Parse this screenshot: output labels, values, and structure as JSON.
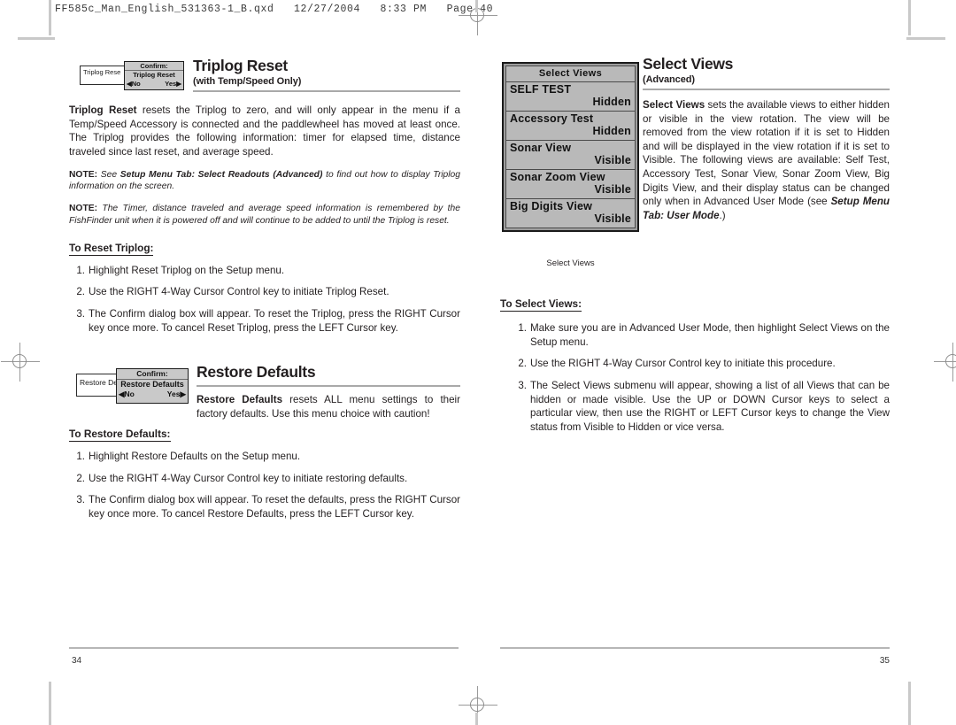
{
  "prepress": {
    "header": "FF585c_Man_English_531363-1_B.qxd   12/27/2004   8:33 PM   Page 40"
  },
  "left_page": {
    "folio": "34",
    "triplog": {
      "title": "Triplog Reset",
      "subtitle": "(with Temp/Speed Only)",
      "figure": {
        "menu_item": "Triplog Rese",
        "dialog_title": "Confirm:",
        "dialog_body": "Triplog Reset",
        "dialog_no": "◀No",
        "dialog_yes": "Yes▶"
      },
      "intro_bold": "Triplog Reset",
      "intro_text": " resets the Triplog to zero, and will only appear in the menu if a Temp/Speed Accessory is connected and the paddlewheel has moved at least once. The Triplog provides the following information: timer for elapsed time, distance traveled since last reset, and average speed.",
      "note1_label": "NOTE:",
      "note1_pre": " See ",
      "note1_bold": "Setup Menu Tab: Select Readouts (Advanced)",
      "note1_post": " to find out how to display Triplog information on the screen.",
      "note2_label": "NOTE:",
      "note2_text": " The Timer, distance traveled and average speed information is remembered by the FishFinder unit when it is powered off and will continue to be added to until the Triplog is reset.",
      "procedure_heading": "To Reset Triplog:",
      "steps": [
        {
          "num": "1.",
          "text": "Highlight Reset Triplog on the Setup menu."
        },
        {
          "num": "2.",
          "text": "Use the RIGHT 4-Way Cursor Control key to initiate Triplog Reset."
        },
        {
          "num": "3.",
          "text": "The Confirm dialog box will appear. To reset the Triplog, press the RIGHT Cursor key once more. To cancel Reset Triplog, press the LEFT Cursor key."
        }
      ]
    },
    "restore": {
      "title": "Restore Defaults",
      "figure": {
        "menu_item": "Restore De",
        "dialog_title": "Confirm:",
        "dialog_body": "Restore Defaults",
        "dialog_no": "◀No",
        "dialog_yes": "Yes▶"
      },
      "intro_bold": "Restore Defaults",
      "intro_text": " resets ALL menu settings to their factory defaults. Use this menu choice with caution!",
      "procedure_heading": "To Restore Defaults:",
      "steps": [
        {
          "num": "1.",
          "text": "Highlight Restore Defaults on the Setup menu."
        },
        {
          "num": "2.",
          "text": "Use the RIGHT 4-Way Cursor Control key to initiate restoring defaults."
        },
        {
          "num": "3.",
          "text": "The Confirm dialog box will appear. To reset the defaults,  press the RIGHT Cursor key once more. To cancel Restore Defaults, press the LEFT Cursor key."
        }
      ]
    }
  },
  "right_page": {
    "folio": "35",
    "select_views": {
      "title": "Select Views",
      "subtitle": "(Advanced)",
      "intro_bold": "Select Views",
      "intro_text": " sets the available views to either hidden or visible in the view rotation.  The view will be removed from the view rotation if it is set to Hidden and will be displayed in the view rotation if it is set to Visible. The following views are available: Self Test, Accessory Test, Sonar View, Sonar Zoom View, Big Digits View, and their display status can be changed only when in Advanced User Mode (see ",
      "intro_bold_tail": "Setup Menu Tab: User Mode",
      "intro_tail": ".)",
      "device": {
        "header": "Select Views",
        "caption": "Select Views",
        "rows": [
          {
            "name": "SELF TEST",
            "value": "Hidden"
          },
          {
            "name": "Accessory Test",
            "value": "Hidden"
          },
          {
            "name": "Sonar View",
            "value": "Visible"
          },
          {
            "name": "Sonar Zoom View",
            "value": "Visible"
          },
          {
            "name": "Big Digits View",
            "value": "Visible"
          }
        ]
      },
      "procedure_heading": "To Select Views:",
      "steps": [
        {
          "num": "1.",
          "text": "Make sure you are in Advanced User Mode, then highlight Select Views on the Setup menu."
        },
        {
          "num": "2.",
          "text": "Use the RIGHT 4-Way Cursor Control key to initiate this procedure."
        },
        {
          "num": "3.",
          "text": "The Select Views submenu will appear, showing a list of all Views that can be hidden or made visible. Use the UP or DOWN Cursor keys to select a particular view, then use the RIGHT or LEFT Cursor keys to change the View status from Visible to Hidden or vice versa."
        }
      ]
    }
  }
}
